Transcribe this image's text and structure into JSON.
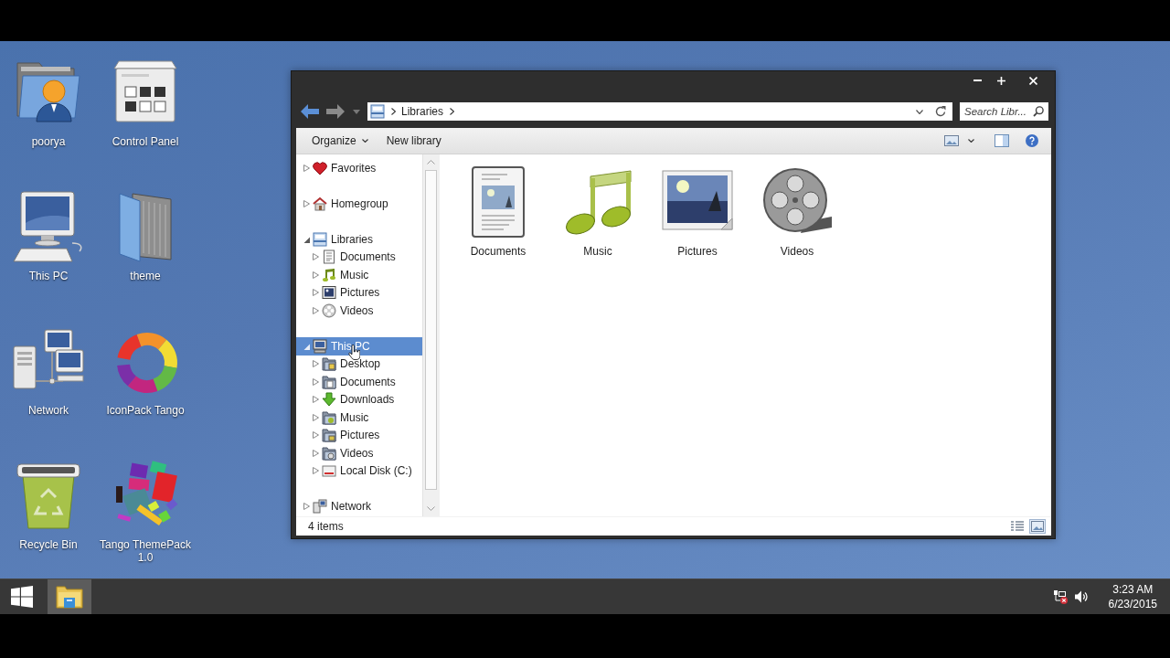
{
  "desktop": {
    "icons": [
      {
        "label": "poorya",
        "kind": "user-folder"
      },
      {
        "label": "Control Panel",
        "kind": "control-panel"
      },
      {
        "label": "This PC",
        "kind": "computer"
      },
      {
        "label": "theme",
        "kind": "folder"
      },
      {
        "label": "Network",
        "kind": "network"
      },
      {
        "label": "IconPack Tango",
        "kind": "iconpack"
      },
      {
        "label": "Recycle Bin",
        "kind": "recycle-bin"
      },
      {
        "label": "Tango ThemePack 1.0",
        "kind": "themepack"
      }
    ]
  },
  "window": {
    "address_bar": {
      "path": [
        "Libraries"
      ]
    },
    "search": {
      "placeholder": "Search Libr..."
    },
    "toolbar": {
      "buttons": [
        {
          "label": "Organize",
          "dropdown": true
        },
        {
          "label": "New library",
          "dropdown": false
        }
      ]
    },
    "navigation": [
      {
        "label": "Favorites",
        "kind": "favorites",
        "expanded": false,
        "selected": false
      },
      {
        "label": "Homegroup",
        "kind": "homegroup",
        "expanded": false,
        "selected": false
      },
      {
        "label": "Libraries",
        "kind": "libraries",
        "expanded": true,
        "selected": false,
        "children": [
          {
            "label": "Documents",
            "kind": "library-documents",
            "expanded": false,
            "selected": false
          },
          {
            "label": "Music",
            "kind": "library-music",
            "expanded": false,
            "selected": false
          },
          {
            "label": "Pictures",
            "kind": "library-pictures",
            "expanded": false,
            "selected": false
          },
          {
            "label": "Videos",
            "kind": "library-videos",
            "expanded": false,
            "selected": false
          }
        ]
      },
      {
        "label": "This PC",
        "kind": "computer",
        "expanded": true,
        "selected": true,
        "children": [
          {
            "label": "Desktop",
            "kind": "desktop",
            "expanded": false,
            "selected": false
          },
          {
            "label": "Documents",
            "kind": "folder-documents",
            "expanded": false,
            "selected": false
          },
          {
            "label": "Downloads",
            "kind": "downloads",
            "expanded": false,
            "selected": false
          },
          {
            "label": "Music",
            "kind": "folder-music",
            "expanded": false,
            "selected": false
          },
          {
            "label": "Pictures",
            "kind": "folder-pictures",
            "expanded": false,
            "selected": false
          },
          {
            "label": "Videos",
            "kind": "folder-videos",
            "expanded": false,
            "selected": false
          },
          {
            "label": "Local Disk (C:)",
            "kind": "drive",
            "expanded": false,
            "selected": false
          }
        ]
      },
      {
        "label": "Network",
        "kind": "network",
        "expanded": false,
        "selected": false
      }
    ],
    "items": [
      {
        "label": "Documents",
        "kind": "documents"
      },
      {
        "label": "Music",
        "kind": "music"
      },
      {
        "label": "Pictures",
        "kind": "pictures"
      },
      {
        "label": "Videos",
        "kind": "videos"
      }
    ],
    "status_bar": {
      "text": "4 items",
      "views": [
        {
          "kind": "details",
          "selected": false
        },
        {
          "kind": "large-icons",
          "selected": true
        }
      ]
    }
  },
  "taskbar": {
    "buttons": [
      {
        "kind": "start",
        "selected": false
      },
      {
        "kind": "file-explorer",
        "selected": true
      }
    ],
    "clock": {
      "time": "3:23 AM",
      "date": "6/23/2015"
    }
  }
}
